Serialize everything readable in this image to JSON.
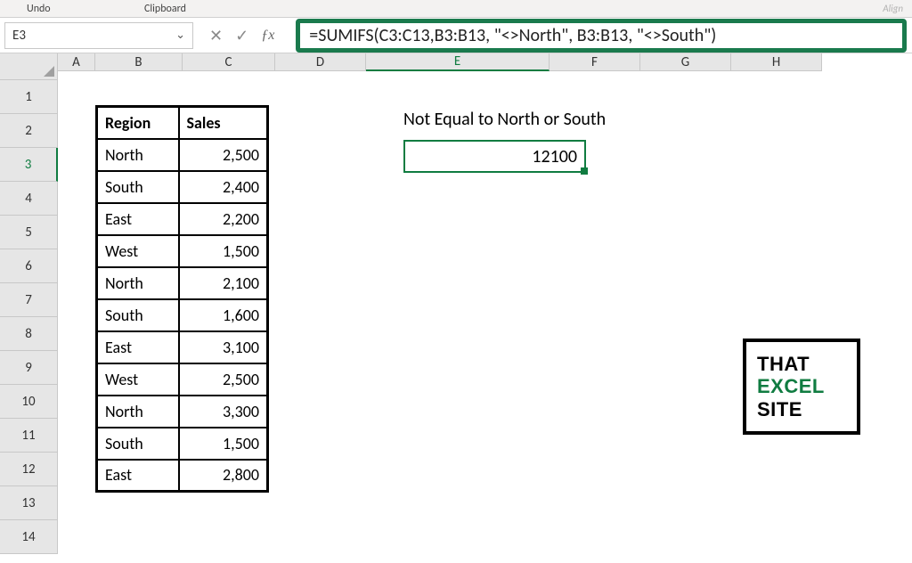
{
  "ribbon": {
    "undo": "Undo",
    "clipboard": "Clipboard",
    "align": "Align"
  },
  "nameBox": "E3",
  "formula": "=SUMIFS(C3:C13,B3:B13, \"<>North\", B3:B13, \"<>South\")",
  "columns": [
    "A",
    "B",
    "C",
    "D",
    "E",
    "F",
    "G",
    "H"
  ],
  "rows": [
    "1",
    "2",
    "3",
    "4",
    "5",
    "6",
    "7",
    "8",
    "9",
    "10",
    "11",
    "12",
    "13",
    "14"
  ],
  "table": {
    "headers": {
      "region": "Region",
      "sales": "Sales"
    },
    "rows": [
      {
        "region": "North",
        "sales": "2,500"
      },
      {
        "region": "South",
        "sales": "2,400"
      },
      {
        "region": "East",
        "sales": "2,200"
      },
      {
        "region": "West",
        "sales": "1,500"
      },
      {
        "region": "North",
        "sales": "2,100"
      },
      {
        "region": "South",
        "sales": "1,600"
      },
      {
        "region": "East",
        "sales": "3,100"
      },
      {
        "region": "West",
        "sales": "2,500"
      },
      {
        "region": "North",
        "sales": "3,300"
      },
      {
        "region": "South",
        "sales": "1,500"
      },
      {
        "region": "East",
        "sales": "2,800"
      }
    ]
  },
  "labelE2": "Not Equal to North or South",
  "resultE3": "12100",
  "logo": {
    "line1": "THAT",
    "line2": "EXCEL",
    "line3": "SITE"
  },
  "icons": {
    "cancel": "✕",
    "accept": "✓"
  },
  "chart_data": {
    "type": "table",
    "title": "Region Sales",
    "columns": [
      "Region",
      "Sales"
    ],
    "rows": [
      [
        "North",
        2500
      ],
      [
        "South",
        2400
      ],
      [
        "East",
        2200
      ],
      [
        "West",
        1500
      ],
      [
        "North",
        2100
      ],
      [
        "South",
        1600
      ],
      [
        "East",
        3100
      ],
      [
        "West",
        2500
      ],
      [
        "North",
        3300
      ],
      [
        "South",
        1500
      ],
      [
        "East",
        2800
      ]
    ],
    "aggregate": {
      "label": "Not Equal to North or South",
      "value": 12100
    }
  }
}
